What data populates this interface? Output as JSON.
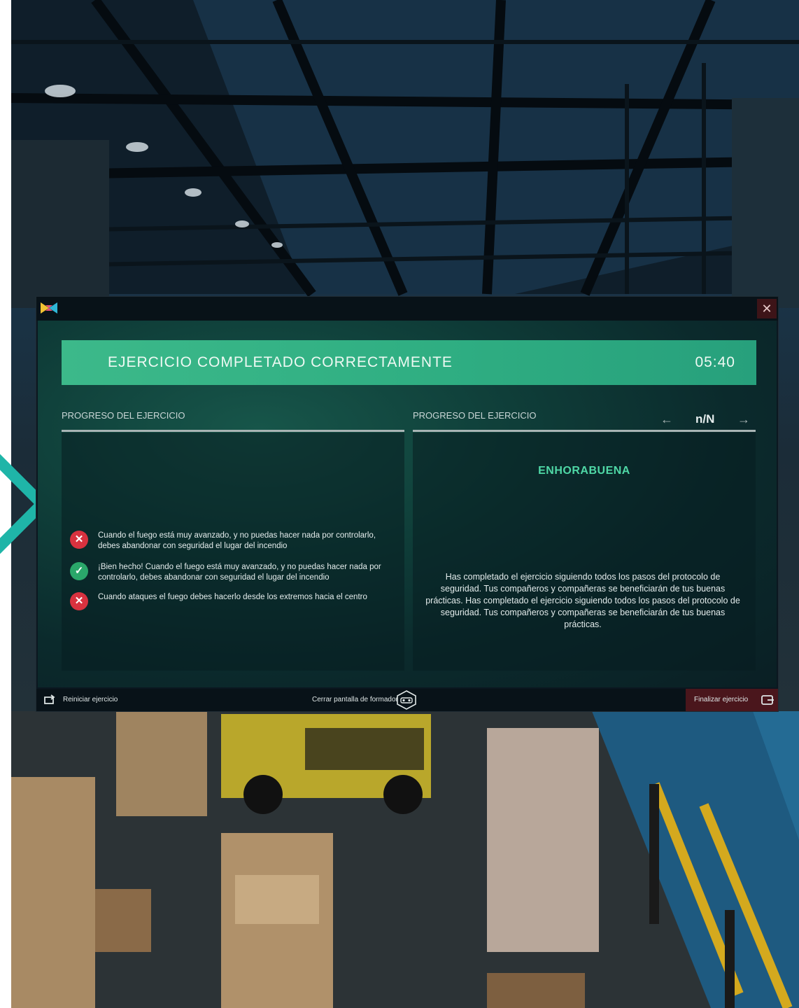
{
  "modal": {
    "close_glyph": "✕",
    "banner": {
      "title": "EJERCICIO COMPLETADO CORRECTAMENTE",
      "time": "05:40"
    },
    "left_column": {
      "heading": "PROGRESO DEL EJERCICIO",
      "items": [
        {
          "status": "error",
          "glyph": "✕",
          "text": "Cuando el fuego está muy avanzado, y no puedas hacer nada por controlarlo, debes abandonar con seguridad el lugar del incendio"
        },
        {
          "status": "success",
          "glyph": "✓",
          "text": "¡Bien hecho! Cuando el fuego está muy avanzado, y no puedas hacer nada por controlarlo, debes abandonar con seguridad el lugar del incendio"
        },
        {
          "status": "error",
          "glyph": "✕",
          "text": "Cuando ataques el fuego debes hacerlo desde los extremos hacia el centro"
        }
      ]
    },
    "right_column": {
      "heading": "PROGRESO DEL EJERCICIO",
      "pager": "n/N",
      "prev_glyph": "←",
      "next_glyph": "→",
      "congrats_title": "ENHORABUENA",
      "congrats_text": "Has completado el ejercicio siguiendo todos los pasos del protocolo de seguridad. Tus compañeros y compañeras se beneficiarán de tus buenas prácticas. Has completado el ejercicio siguiendo todos los pasos del protocolo de seguridad. Tus compañeros y compañeras se beneficiarán de tus buenas prácticas."
    },
    "footer": {
      "restart_label": "Reiniciar ejercicio",
      "close_trainer_label": "Cerrar pantalla de formador",
      "finish_label": "Finalizar ejercicio"
    }
  },
  "colors": {
    "banner": "#2fae82",
    "accent_text": "#4fd8a6",
    "error": "#d8323f",
    "success": "#2aa76a",
    "chevron": "#1fb5a8"
  },
  "icons": [
    "app-logo-icon",
    "close-icon",
    "arrow-left-icon",
    "arrow-right-icon",
    "error-icon",
    "check-icon",
    "restart-icon",
    "vr-headset-icon",
    "exit-icon",
    "chevron-right-icon"
  ]
}
